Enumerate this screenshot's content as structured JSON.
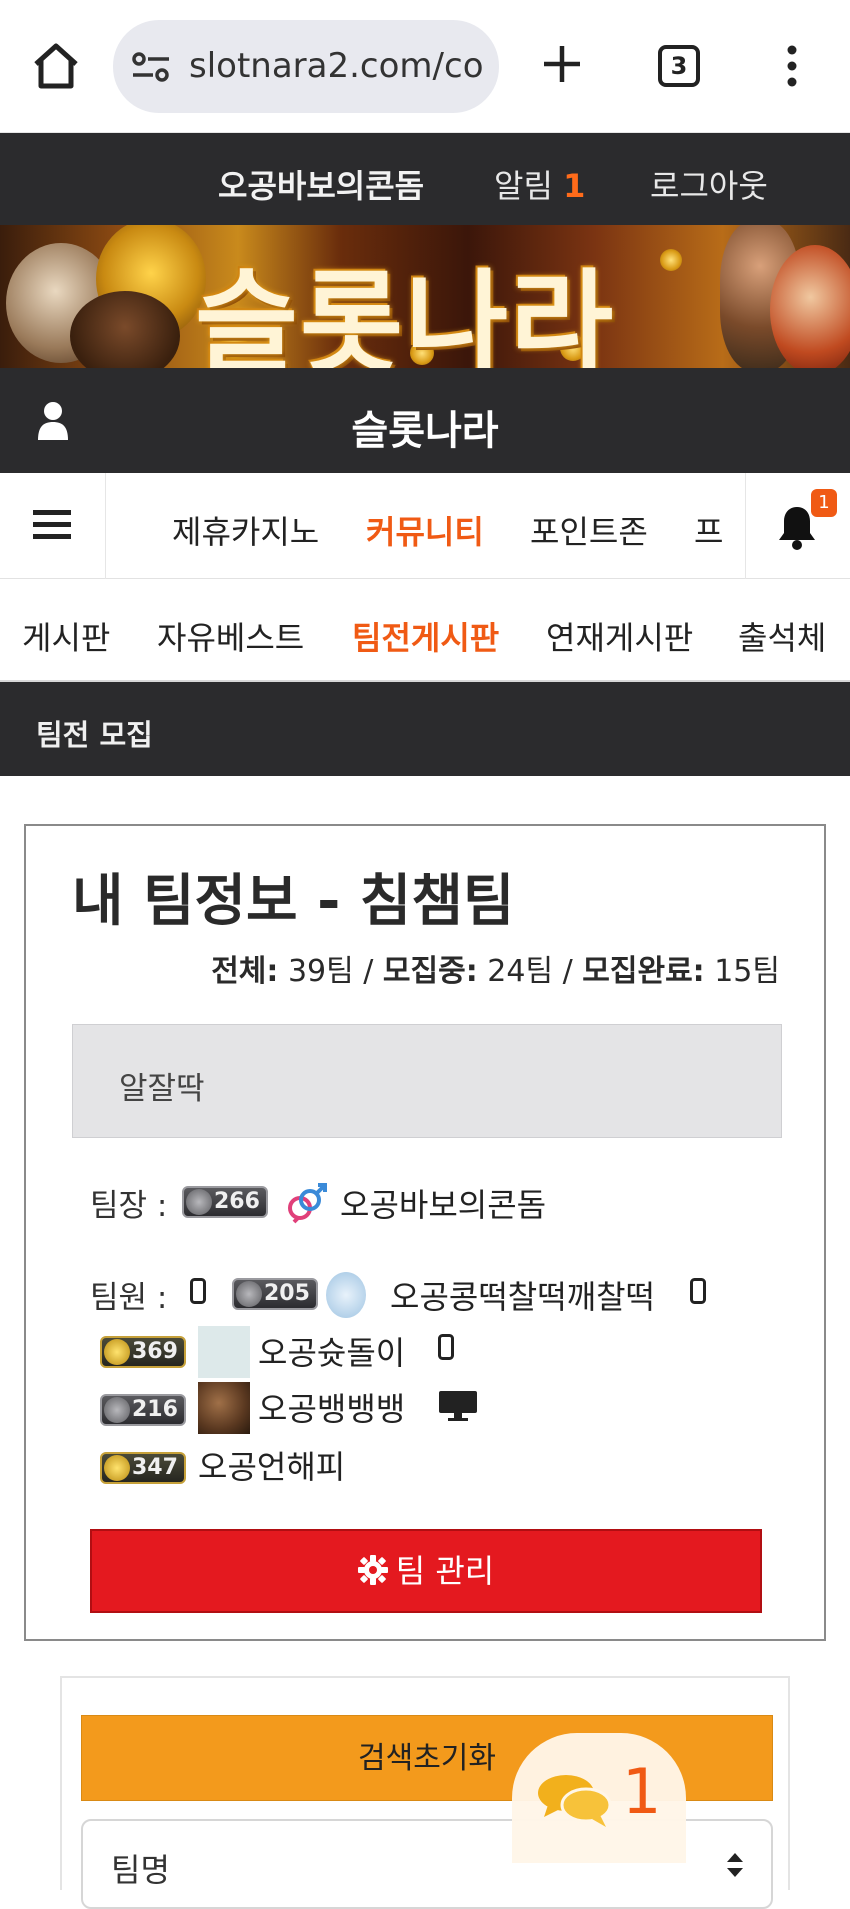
{
  "browser": {
    "url": "slotnara2.com/co",
    "tab_count": "3"
  },
  "topbar": {
    "username": "오공바보의콘돔",
    "notice_label": "알림",
    "notice_count": "1",
    "logout": "로그아웃"
  },
  "banner": {
    "logo_text": "슬롯나라"
  },
  "site": {
    "title": "슬롯나라"
  },
  "main_nav": {
    "items": [
      "제휴카지노",
      "커뮤니티",
      "포인트존",
      "프"
    ],
    "active_index": 1,
    "bell_badge": "1"
  },
  "sub_nav": {
    "items": [
      "게시판",
      "자유베스트",
      "팀전게시판",
      "연재게시판",
      "출석체"
    ],
    "active_index": 2
  },
  "section": {
    "header": "팀전 모집"
  },
  "team": {
    "title": "내 팀정보 - 침챔팀",
    "stats": {
      "total_label": "전체:",
      "total_value": "39팀",
      "recruiting_label": "모집중:",
      "recruiting_value": "24팀",
      "done_label": "모집완료:",
      "done_value": "15팀",
      "separator": "/"
    },
    "description": "알잘딱",
    "leader_label": "팀장 :",
    "leader": {
      "level": "266",
      "name": "오공바보의콘돔"
    },
    "members_label": "팀원 :",
    "members": [
      {
        "level": "205",
        "name": "오공콩떡찰떡깨찰떡",
        "device": "mobile"
      },
      {
        "level": "369",
        "name": "오공슛돌이",
        "device": "mobile"
      },
      {
        "level": "216",
        "name": "오공뱅뱅뱅",
        "device": "desktop"
      },
      {
        "level": "347",
        "name": "오공언해피",
        "device": ""
      }
    ],
    "manage_button": "팀 관리"
  },
  "search": {
    "reset_button": "검색초기화",
    "select_value": "팀명"
  },
  "chat": {
    "count": "1"
  },
  "colors": {
    "accent": "#f05a14",
    "dark_bar": "#2b2b2d",
    "manage_button": "#e4191f",
    "reset_button": "#f39a1c"
  }
}
